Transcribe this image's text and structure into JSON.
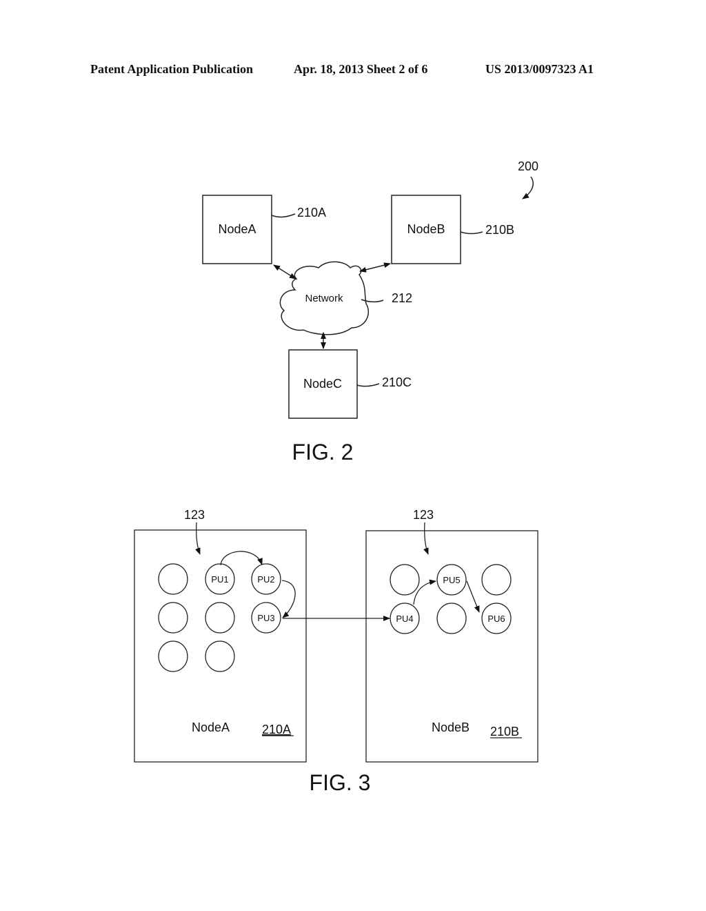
{
  "header": {
    "publication": "Patent Application Publication",
    "date_sheet": "Apr. 18, 2013  Sheet 2 of 6",
    "number": "US 2013/0097323 A1"
  },
  "fig2": {
    "caption": "FIG. 2",
    "ref_system": "200",
    "nodes": [
      {
        "label": "NodeA",
        "ref": "210A"
      },
      {
        "label": "NodeB",
        "ref": "210B"
      },
      {
        "label": "NodeC",
        "ref": "210C"
      }
    ],
    "network": {
      "label": "Network",
      "ref": "212"
    }
  },
  "fig3": {
    "caption": "FIG. 3",
    "left": {
      "label": "NodeA",
      "ref": "210A",
      "pointer_ref": "123",
      "units": [
        "",
        "PU1",
        "PU2",
        "",
        "",
        "PU3",
        "",
        ""
      ]
    },
    "right": {
      "label": "NodeB",
      "ref": "210B",
      "pointer_ref": "123",
      "units": [
        "",
        "PU5",
        "",
        "PU4",
        "",
        "PU6"
      ]
    }
  }
}
